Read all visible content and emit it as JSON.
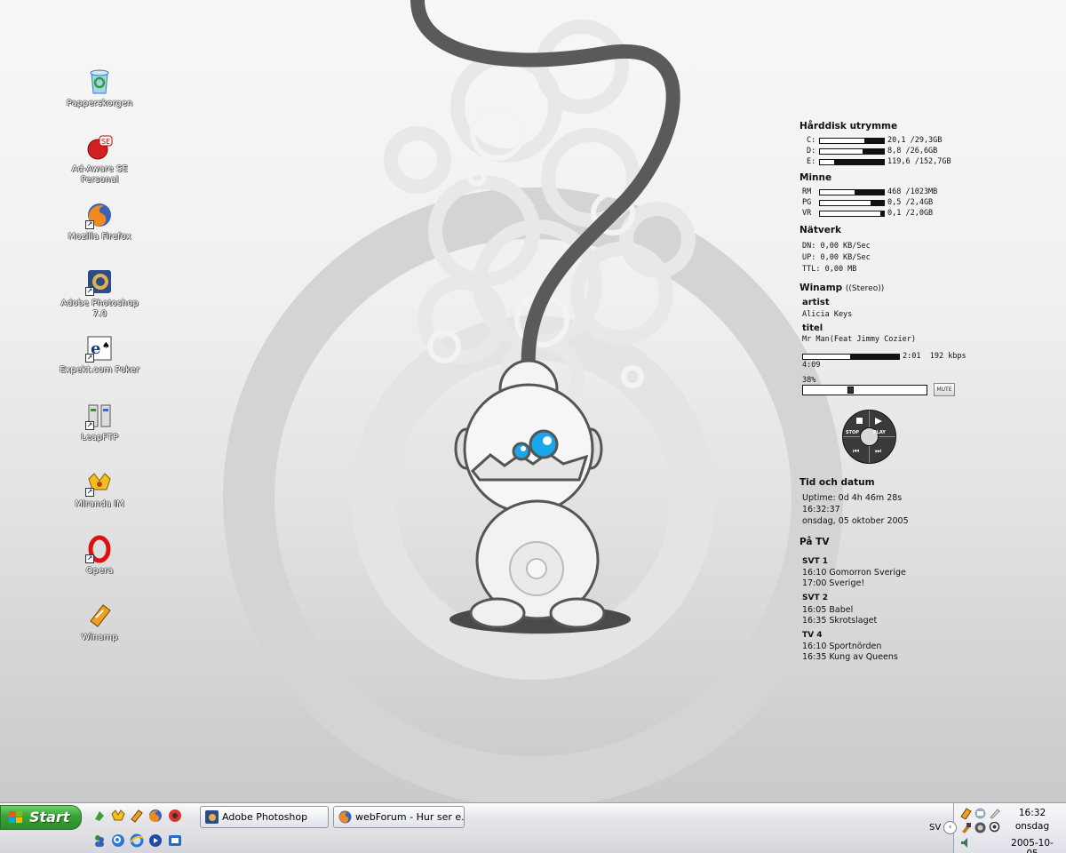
{
  "desktop_icons": [
    {
      "id": "recycle",
      "label": "Papperskorgen",
      "icon": "recycle-bin-icon",
      "shortcut": false
    },
    {
      "id": "adaware",
      "label": "Ad-Aware SE Personal",
      "icon": "adaware-icon",
      "shortcut": false
    },
    {
      "id": "firefox",
      "label": "Mozilla Firefox",
      "icon": "firefox-icon",
      "shortcut": true
    },
    {
      "id": "photoshop",
      "label": "Adobe Photoshop 7.0",
      "icon": "photoshop-icon",
      "shortcut": true
    },
    {
      "id": "expekt",
      "label": "Expekt.com Poker",
      "icon": "expekt-icon",
      "shortcut": true
    },
    {
      "id": "leapftp",
      "label": "LeapFTP",
      "icon": "leapftp-icon",
      "shortcut": true
    },
    {
      "id": "miranda",
      "label": "Miranda IM",
      "icon": "miranda-icon",
      "shortcut": true
    },
    {
      "id": "opera",
      "label": "Opera",
      "icon": "opera-icon",
      "shortcut": true
    },
    {
      "id": "winamp",
      "label": "Winamp",
      "icon": "winamp-icon",
      "shortcut": false
    }
  ],
  "panel": {
    "disk": {
      "title": "Hårddisk utrymme",
      "rows": [
        {
          "key": "C:",
          "value": "20,1  /29,3GB",
          "fill": 0.69
        },
        {
          "key": "D:",
          "value": "8,8  /26,6GB",
          "fill": 0.67
        },
        {
          "key": "E:",
          "value": "119,6 /152,7GB",
          "fill": 0.22
        }
      ]
    },
    "memory": {
      "title": "Minne",
      "rows": [
        {
          "key": "RM",
          "value": "468 /1023MB",
          "fill": 0.54
        },
        {
          "key": "PG",
          "value": "0,5 /2,4GB",
          "fill": 0.79
        },
        {
          "key": "VR",
          "value": "0,1 /2,0GB",
          "fill": 0.95
        }
      ]
    },
    "network": {
      "title": "Nätverk",
      "dn": "DN: 0,00 KB/Sec",
      "up": "UP: 0,00 KB/Sec",
      "ttl": "TTL: 0,00 MB"
    },
    "winamp": {
      "title": "Winamp",
      "mode": "((Stereo))",
      "artist_label": "artist",
      "artist": "Alicia Keys",
      "title_label": "titel",
      "track": "Mr Man(Feat Jimmy Cozier)",
      "elapsed": "2:01",
      "bitrate": "192 kbps",
      "length": "4:09",
      "progress": 0.49,
      "volume_label": "38%",
      "volume": 0.38,
      "mute_label": "MUTE",
      "stop_label": "STOP",
      "play_label": "PLAY"
    },
    "time": {
      "title": "Tid och datum",
      "uptime": "Uptime: 0d 4h 46m 28s",
      "clock": "16:32:37",
      "date": "onsdag, 05 oktober 2005"
    },
    "tv": {
      "title": "På TV",
      "channels": [
        {
          "name": "SVT 1",
          "shows": [
            "16:10 Gomorron Sverige",
            "17:00 Sverige!"
          ]
        },
        {
          "name": "SVT 2",
          "shows": [
            "16:05 Babel",
            "16:35 Skrotslaget"
          ]
        },
        {
          "name": "TV 4",
          "shows": [
            "16:10 Sportnörden",
            "16:35 Kung av Queens"
          ]
        }
      ]
    }
  },
  "taskbar": {
    "start_label": "Start",
    "quick_launch": [
      "winamp-ql-icon",
      "miranda-ql-icon",
      "winamp-bolt-ql-icon",
      "firefox-ql-icon",
      "opera-ql-icon",
      "messenger-ql-icon",
      "search-ql-icon",
      "ie-ql-icon",
      "media-player-ql-icon",
      "outlook-ql-icon"
    ],
    "tasks": [
      {
        "label": "Adobe Photoshop",
        "icon": "photoshop-task-icon"
      },
      {
        "label": "webForum - Hur ser e...",
        "icon": "firefox-task-icon"
      }
    ],
    "language": "SV",
    "clock_time": "16:32",
    "clock_day": "onsdag",
    "clock_date": "2005-10-05"
  },
  "colors": {
    "panel_text": "#111111",
    "taskbar": "#dcdde3",
    "start_green": "#3aa236",
    "robot_eye": "#19a8ea"
  }
}
